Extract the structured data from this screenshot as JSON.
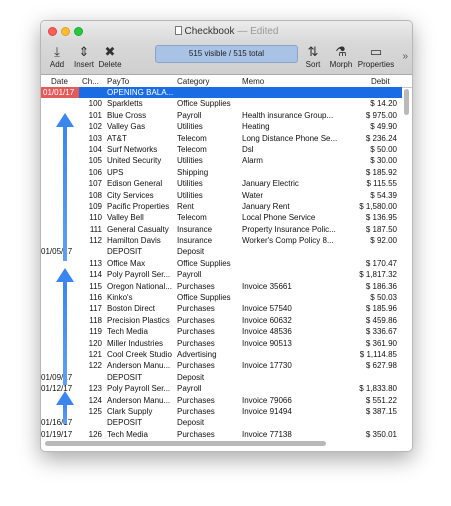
{
  "window": {
    "title": "Checkbook",
    "status": "Edited",
    "title_separator": "—"
  },
  "toolbar": {
    "add": "Add",
    "insert": "Insert",
    "delete": "Delete",
    "record_count": "515 visible / 515 total",
    "sort": "Sort",
    "morph": "Morph",
    "properties": "Properties",
    "more": "»",
    "icons": {
      "add": "add-icon",
      "insert": "insert-icon",
      "delete": "delete-icon",
      "sort": "sort-icon",
      "morph": "flask-icon",
      "properties": "properties-icon"
    }
  },
  "columns": {
    "date": "Date",
    "num": "Ch...",
    "payto": "PayTo",
    "category": "Category",
    "memo": "Memo",
    "debit": "Debit"
  },
  "colors": {
    "selection": "#1a6ce4",
    "selected_date": "#e25b5b",
    "arrow": "#3a86f0"
  },
  "rows": [
    {
      "date": "01/01/17",
      "num": "",
      "payto": "OPENING BALA...",
      "category": "",
      "memo": "",
      "debit": ""
    },
    {
      "date": "",
      "num": "100",
      "payto": "Sparkletts",
      "category": "Office Supplies",
      "memo": "",
      "debit": "$ 14.20"
    },
    {
      "date": "",
      "num": "101",
      "payto": "Blue Cross",
      "category": "Payroll",
      "memo": "Health insurance Group...",
      "debit": "$ 975.00"
    },
    {
      "date": "",
      "num": "102",
      "payto": "Valley Gas",
      "category": "Utilities",
      "memo": "Heating",
      "debit": "$ 49.90"
    },
    {
      "date": "",
      "num": "103",
      "payto": "AT&T",
      "category": "Telecom",
      "memo": "Long Distance Phone Se...",
      "debit": "$ 236.24"
    },
    {
      "date": "",
      "num": "104",
      "payto": "Surf Networks",
      "category": "Telecom",
      "memo": "Dsl",
      "debit": "$ 50.00"
    },
    {
      "date": "",
      "num": "105",
      "payto": "United Security",
      "category": "Utilities",
      "memo": "Alarm",
      "debit": "$ 30.00"
    },
    {
      "date": "",
      "num": "106",
      "payto": "UPS",
      "category": "Shipping",
      "memo": "",
      "debit": "$ 185.92"
    },
    {
      "date": "",
      "num": "107",
      "payto": "Edison General",
      "category": "Utilities",
      "memo": "January Electric",
      "debit": "$ 115.55"
    },
    {
      "date": "",
      "num": "108",
      "payto": "City Services",
      "category": "Utilities",
      "memo": "Water",
      "debit": "$ 54.39"
    },
    {
      "date": "",
      "num": "109",
      "payto": "Pacific Properties",
      "category": "Rent",
      "memo": "January Rent",
      "debit": "$ 1,580.00"
    },
    {
      "date": "",
      "num": "110",
      "payto": "Valley Bell",
      "category": "Telecom",
      "memo": "Local Phone Service",
      "debit": "$ 136.95"
    },
    {
      "date": "",
      "num": "111",
      "payto": "General Casualty",
      "category": "Insurance",
      "memo": "Property Insurance Polic...",
      "debit": "$ 187.50"
    },
    {
      "date": "",
      "num": "112",
      "payto": "Hamilton Davis",
      "category": "Insurance",
      "memo": "Worker's Comp Policy 8...",
      "debit": "$ 92.00"
    },
    {
      "date": "01/05/17",
      "num": "",
      "payto": "DEPOSIT",
      "category": "Deposit",
      "memo": "",
      "debit": ""
    },
    {
      "date": "",
      "num": "113",
      "payto": "Office Max",
      "category": "Office Supplies",
      "memo": "",
      "debit": "$ 170.47"
    },
    {
      "date": "",
      "num": "114",
      "payto": "Poly Payroll Ser...",
      "category": "Payroll",
      "memo": "",
      "debit": "$ 1,817.32"
    },
    {
      "date": "",
      "num": "115",
      "payto": "Oregon National...",
      "category": "Purchases",
      "memo": "Invoice 35661",
      "debit": "$ 186.36"
    },
    {
      "date": "",
      "num": "116",
      "payto": "Kinko's",
      "category": "Office Supplies",
      "memo": "",
      "debit": "$ 50.03"
    },
    {
      "date": "",
      "num": "117",
      "payto": "Boston Direct",
      "category": "Purchases",
      "memo": "Invoice 57540",
      "debit": "$ 185.96"
    },
    {
      "date": "",
      "num": "118",
      "payto": "Precision Plastics",
      "category": "Purchases",
      "memo": "Invoice 60632",
      "debit": "$ 459.86"
    },
    {
      "date": "",
      "num": "119",
      "payto": "Tech Media",
      "category": "Purchases",
      "memo": "Invoice 48536",
      "debit": "$ 336.67"
    },
    {
      "date": "",
      "num": "120",
      "payto": "Miller Industries",
      "category": "Purchases",
      "memo": "Invoice 90513",
      "debit": "$ 361.90"
    },
    {
      "date": "",
      "num": "121",
      "payto": "Cool Creek Studio",
      "category": "Advertising",
      "memo": "",
      "debit": "$ 1,114.85"
    },
    {
      "date": "",
      "num": "122",
      "payto": "Anderson Manu...",
      "category": "Purchases",
      "memo": "Invoice 17730",
      "debit": "$ 627.98"
    },
    {
      "date": "01/09/17",
      "num": "",
      "payto": "DEPOSIT",
      "category": "Deposit",
      "memo": "",
      "debit": ""
    },
    {
      "date": "01/12/17",
      "num": "123",
      "payto": "Poly Payroll Ser...",
      "category": "Payroll",
      "memo": "",
      "debit": "$ 1,833.80"
    },
    {
      "date": "",
      "num": "124",
      "payto": "Anderson Manu...",
      "category": "Purchases",
      "memo": "Invoice 79066",
      "debit": "$ 551.22"
    },
    {
      "date": "",
      "num": "125",
      "payto": "Clark Supply",
      "category": "Purchases",
      "memo": "Invoice 91494",
      "debit": "$ 387.15"
    },
    {
      "date": "01/16/17",
      "num": "",
      "payto": "DEPOSIT",
      "category": "Deposit",
      "memo": "",
      "debit": ""
    },
    {
      "date": "01/19/17",
      "num": "126",
      "payto": "Tech Media",
      "category": "Purchases",
      "memo": "Invoice 77138",
      "debit": "$ 350.01"
    }
  ]
}
